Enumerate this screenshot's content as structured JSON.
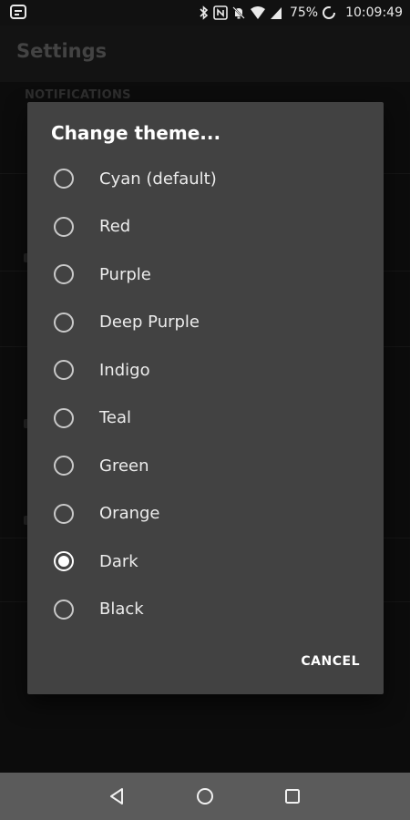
{
  "status_bar": {
    "battery": "75%",
    "time": "10:09:49",
    "icons": [
      "app-notification-icon",
      "bluetooth-icon",
      "nfc-icon",
      "mute-icon",
      "wifi-icon",
      "cell-signal-icon",
      "battery-saver-icon"
    ]
  },
  "app_bar": {
    "title": "Settings"
  },
  "background": {
    "section_header": "NOTIFICATIONS"
  },
  "dialog": {
    "title": "Change theme...",
    "options": [
      {
        "label": "Cyan (default)",
        "selected": false
      },
      {
        "label": "Red",
        "selected": false
      },
      {
        "label": "Purple",
        "selected": false
      },
      {
        "label": "Deep Purple",
        "selected": false
      },
      {
        "label": "Indigo",
        "selected": false
      },
      {
        "label": "Teal",
        "selected": false
      },
      {
        "label": "Green",
        "selected": false
      },
      {
        "label": "Orange",
        "selected": false
      },
      {
        "label": "Dark",
        "selected": true
      },
      {
        "label": "Black",
        "selected": false
      }
    ],
    "cancel_label": "CANCEL"
  },
  "nav_bar": {
    "icons": [
      "back-icon",
      "home-icon",
      "recents-icon"
    ]
  },
  "colors": {
    "dialog_background": "#424242",
    "screen_background": "#111111",
    "nav_bar": "#5b5b5b",
    "text_primary": "#ffffff"
  }
}
